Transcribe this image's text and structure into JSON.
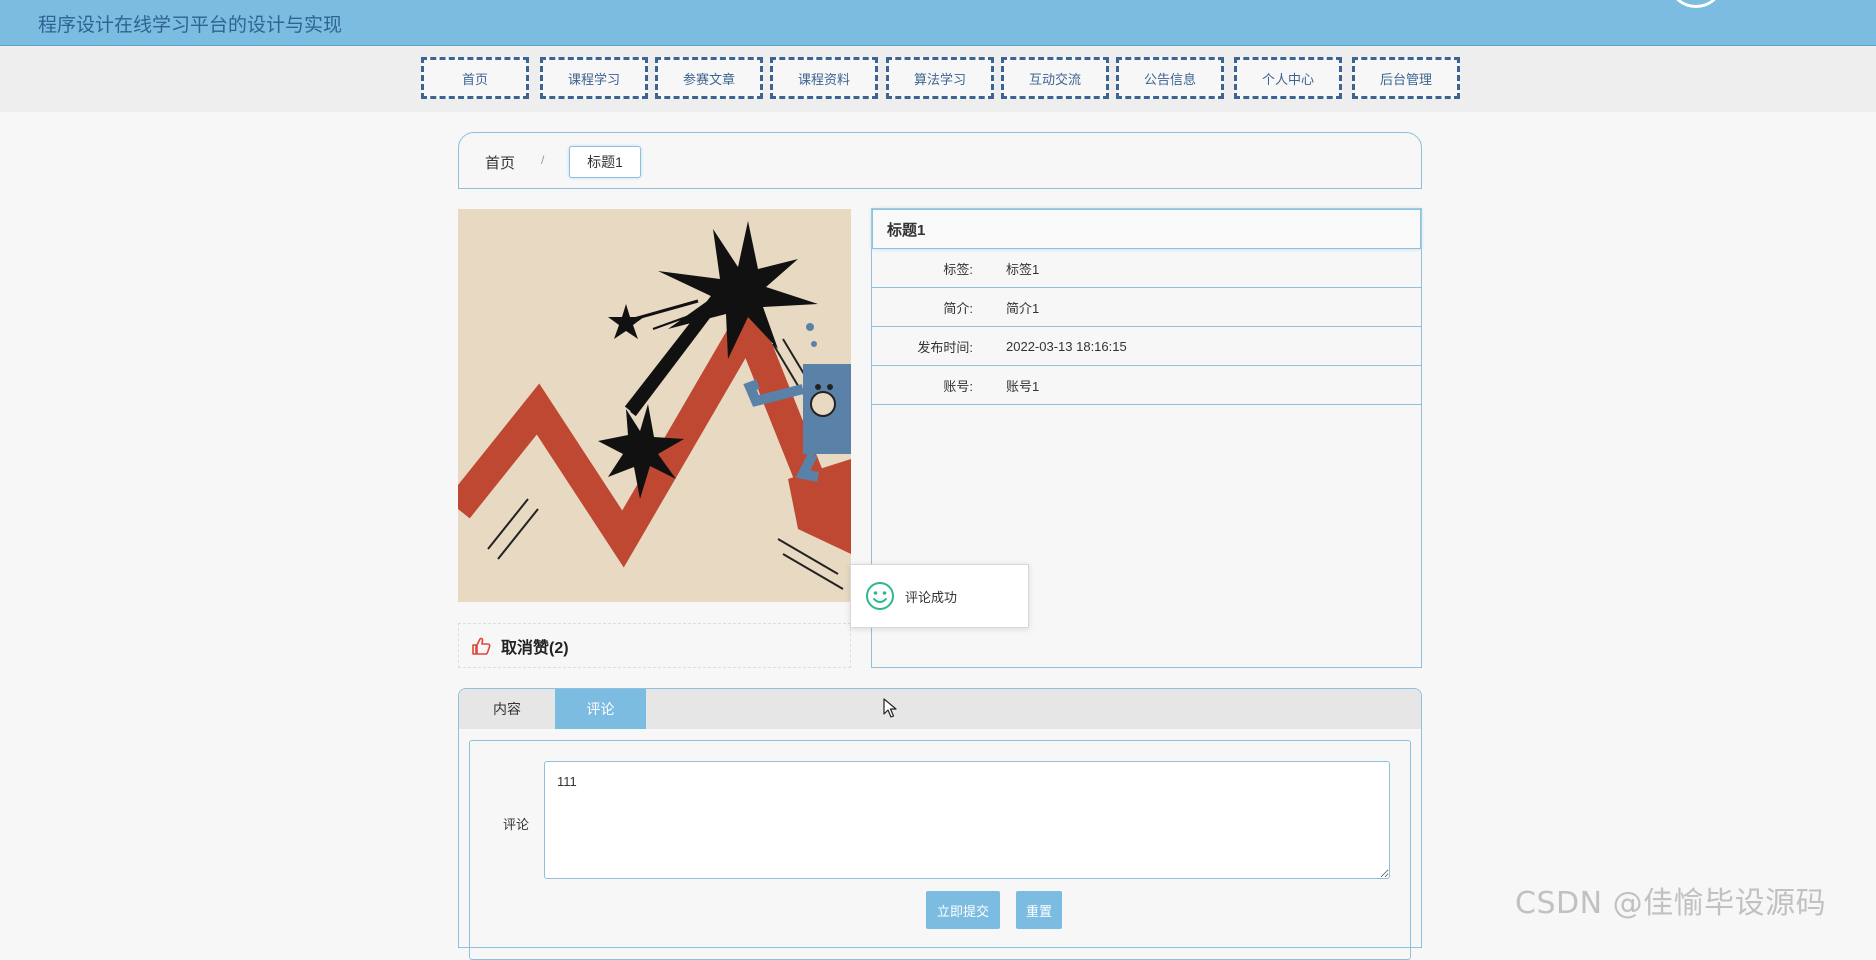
{
  "header": {
    "site_title": "程序设计在线学习平台的设计与实现"
  },
  "nav": {
    "items": [
      "首页",
      "课程学习",
      "参赛文章",
      "课程资料",
      "算法学习",
      "互动交流",
      "公告信息",
      "个人中心",
      "后台管理"
    ]
  },
  "breadcrumb": {
    "home": "首页",
    "separator": "/",
    "current": "标题1"
  },
  "detail": {
    "title": "标题1",
    "rows": [
      {
        "label": "标签:",
        "value": "标签1"
      },
      {
        "label": "简介:",
        "value": "简介1"
      },
      {
        "label": "发布时间:",
        "value": "2022-03-13 18:16:15"
      },
      {
        "label": "账号:",
        "value": "账号1"
      }
    ]
  },
  "like": {
    "label": "取消赞(2)"
  },
  "toast": {
    "message": "评论成功"
  },
  "tabs": {
    "content_label": "内容",
    "comment_label": "评论"
  },
  "comment_form": {
    "label": "评论",
    "value": "111",
    "submit_label": "立即提交",
    "reset_label": "重置"
  },
  "watermark": {
    "text": "CSDN @佳愉毕设源码"
  },
  "colors": {
    "header_bg": "#7dbce1",
    "nav_border": "#3d6491",
    "panel_border": "#8fc1dc",
    "button_bg": "#7dbce1",
    "like_icon": "#e0463a",
    "toast_icon": "#2fb98a"
  },
  "icons": {
    "like": "thumbs-up-icon",
    "toast": "smile-icon",
    "cursor": "mouse-pointer-icon"
  }
}
